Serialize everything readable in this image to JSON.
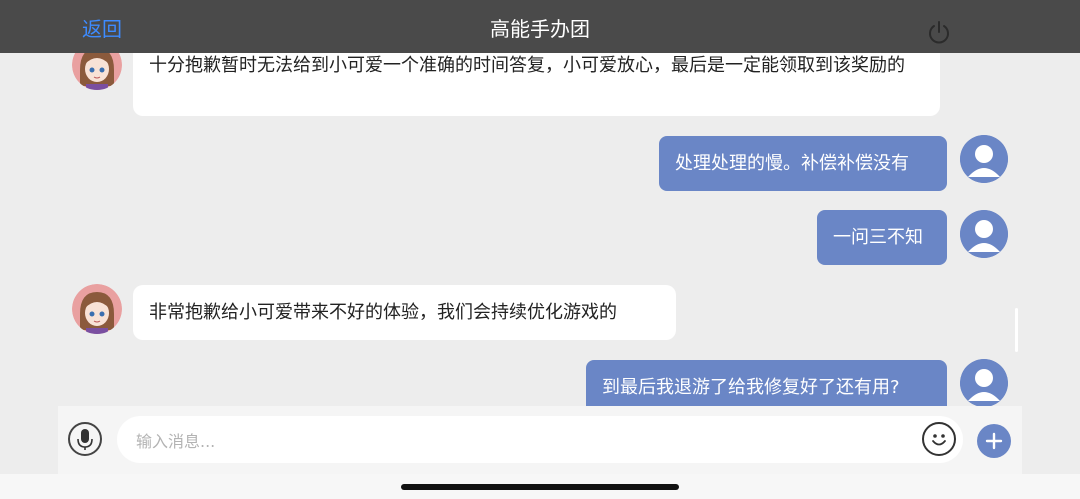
{
  "header": {
    "back_label": "返回",
    "title": "高能手办团"
  },
  "messages": [
    {
      "side": "left",
      "text": "十分抱歉暂时无法给到小可爱一个准确的时间答复，小可爱放心，最后是一定能领取到该奖励的"
    },
    {
      "side": "right",
      "text": "处理处理的慢。补偿补偿没有"
    },
    {
      "side": "right",
      "text": "一问三不知"
    },
    {
      "side": "left",
      "text": "非常抱歉给小可爱带来不好的体验，我们会持续优化游戏的"
    },
    {
      "side": "right",
      "text": "到最后我退游了给我修复好了还有用?"
    }
  ],
  "composer": {
    "placeholder": "输入消息..."
  },
  "icons": {
    "power": "power-icon",
    "mic": "microphone-icon",
    "emoji": "emoji-icon",
    "plus": "plus-icon",
    "user_avatar": "user-avatar-icon",
    "agent_avatar": "agent-avatar"
  },
  "colors": {
    "header_bg": "#4a4a4a",
    "accent_link": "#3d8bff",
    "user_bubble": "#6a86c6",
    "agent_bubble": "#ffffff",
    "background": "#ededed"
  }
}
